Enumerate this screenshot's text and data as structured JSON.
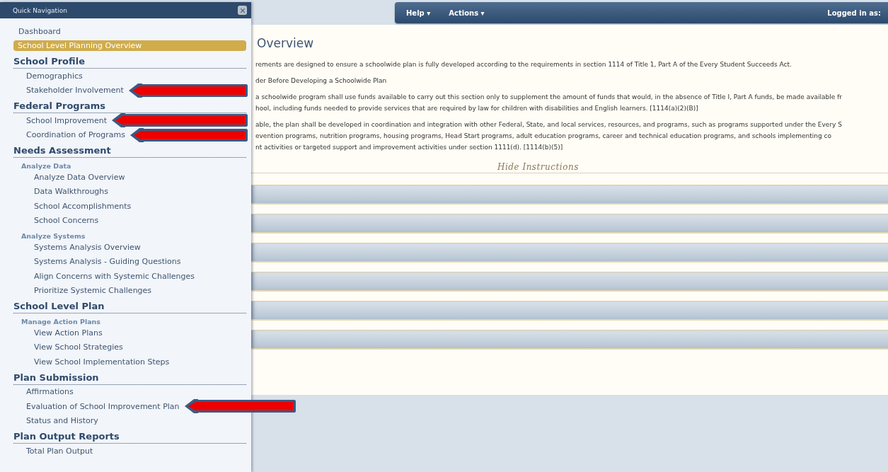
{
  "sidebar": {
    "title": "Quick Navigation",
    "items": [
      {
        "label": "Dashboard",
        "selected": false
      },
      {
        "label": "School Level Planning Overview",
        "selected": true
      }
    ],
    "sections": [
      {
        "heading": "School Profile",
        "children": [
          {
            "kind": "link",
            "label": "Demographics",
            "selected": false
          },
          {
            "kind": "link",
            "label": "Stakeholder Involvement",
            "selected": false,
            "arrow": {
              "kind": "short"
            }
          }
        ]
      },
      {
        "heading": "Federal Programs",
        "children": [
          {
            "kind": "link",
            "label": "School Improvement",
            "selected": false,
            "arrow": {
              "kind": "short"
            }
          },
          {
            "kind": "link",
            "label": "Coordination of Programs",
            "selected": false,
            "arrow": {
              "kind": "short"
            }
          }
        ]
      },
      {
        "heading": "Needs Assessment",
        "children": [
          {
            "kind": "group",
            "label": "Analyze Data",
            "children": [
              {
                "kind": "link",
                "label": "Analyze Data Overview",
                "selected": false
              },
              {
                "kind": "link",
                "label": "Data Walkthroughs",
                "selected": false
              },
              {
                "kind": "link",
                "label": "School Accomplishments",
                "selected": false
              },
              {
                "kind": "link",
                "label": "School Concerns",
                "selected": false
              }
            ]
          },
          {
            "kind": "group",
            "label": "Analyze Systems",
            "children": [
              {
                "kind": "link",
                "label": "Systems Analysis Overview",
                "selected": false
              },
              {
                "kind": "link",
                "label": "Systems Analysis - Guiding Questions",
                "selected": false
              },
              {
                "kind": "link",
                "label": "Align Concerns with Systemic Challenges",
                "selected": false
              },
              {
                "kind": "link",
                "label": "Prioritize Systemic Challenges",
                "selected": false
              }
            ]
          }
        ]
      },
      {
        "heading": "School Level Plan",
        "children": [
          {
            "kind": "group",
            "label": "Manage Action Plans",
            "children": [
              {
                "kind": "link",
                "label": "View Action Plans",
                "selected": false
              },
              {
                "kind": "link",
                "label": "View School Strategies",
                "selected": false
              },
              {
                "kind": "link",
                "label": "View School Implementation Steps",
                "selected": false
              }
            ]
          }
        ]
      },
      {
        "heading": "Plan Submission",
        "children": [
          {
            "kind": "link",
            "label": "Affirmations",
            "selected": false
          },
          {
            "kind": "link",
            "label": "Evaluation of School Improvement Plan",
            "selected": false,
            "arrow": {
              "kind": "long"
            }
          },
          {
            "kind": "link",
            "label": "Status and History",
            "selected": false
          }
        ]
      },
      {
        "heading": "Plan Output Reports",
        "children": [
          {
            "kind": "link",
            "label": "Total Plan Output",
            "selected": false
          }
        ]
      }
    ]
  },
  "top_bar": {
    "menus": [
      {
        "label": "Help",
        "caret": "▾"
      },
      {
        "label": "Actions",
        "caret": "▾"
      }
    ],
    "user_label": "Logged in as:"
  },
  "content": {
    "title": "Overview",
    "paragraphs": [
      [
        "rements are designed to ensure a schoolwide plan is fully developed according to the requirements in section 1114 of Title 1, Part A of the Every Student Succeeds Act."
      ],
      [
        "der Before Developing a Schoolwide Plan"
      ],
      [
        "a schoolwide program shall use funds available to carry out this section only to supplement the amount of funds that would, in the absence of Title I, Part A funds, be made available fr",
        "hool, including funds needed to provide services that are required by law for children with disabilities and English learners. [1114(a)(2)(B)]"
      ],
      [
        "able, the plan shall be developed in coordination and integration with other Federal, State, and local services, resources, and programs, such as programs supported under the Every S",
        "evention programs, nutrition programs, housing programs, Head Start programs, adult education programs, career and technical education programs, and schools implementing co",
        "nt activities or targeted support and improvement activities under section 1111(d). [1114(b)(5)]"
      ]
    ],
    "toggle_link": "Hide Instructions",
    "panels": [
      {
        "expanded": false
      },
      {
        "expanded": false
      },
      {
        "expanded": false
      },
      {
        "expanded": false
      },
      {
        "expanded": false
      },
      {
        "expanded": false
      }
    ]
  }
}
